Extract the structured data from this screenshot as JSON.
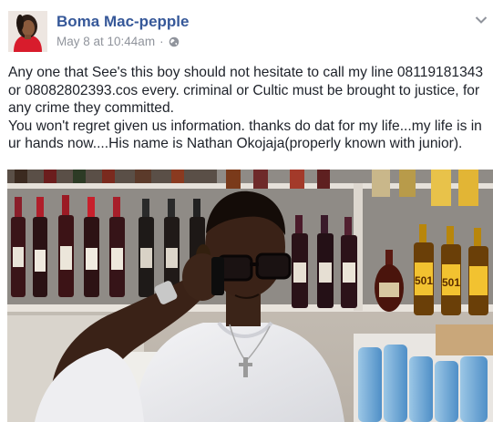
{
  "post": {
    "author": "Boma Mac-pepple",
    "date": "May 8 at 10:44am",
    "separator": "·",
    "privacy_icon": "globe-icon",
    "menu_icon": "chevron-down-icon",
    "paragraph_1": "Any one that See's this boy should not hesitate to call my line 08119181343 or 08082802393.cos every. criminal or Cultic must be brought to justice, for any crime they committed.",
    "paragraph_2": "You won't regret given us information. thanks do dat for my life...my life is in ur hands now....His name is Nathan Okojaja(properly known with junior)."
  },
  "photo": {
    "shelf_label_left": "501",
    "shelf_label_right": "501"
  },
  "colors": {
    "author": "#365899",
    "meta": "#90949c",
    "text": "#1d2129"
  }
}
